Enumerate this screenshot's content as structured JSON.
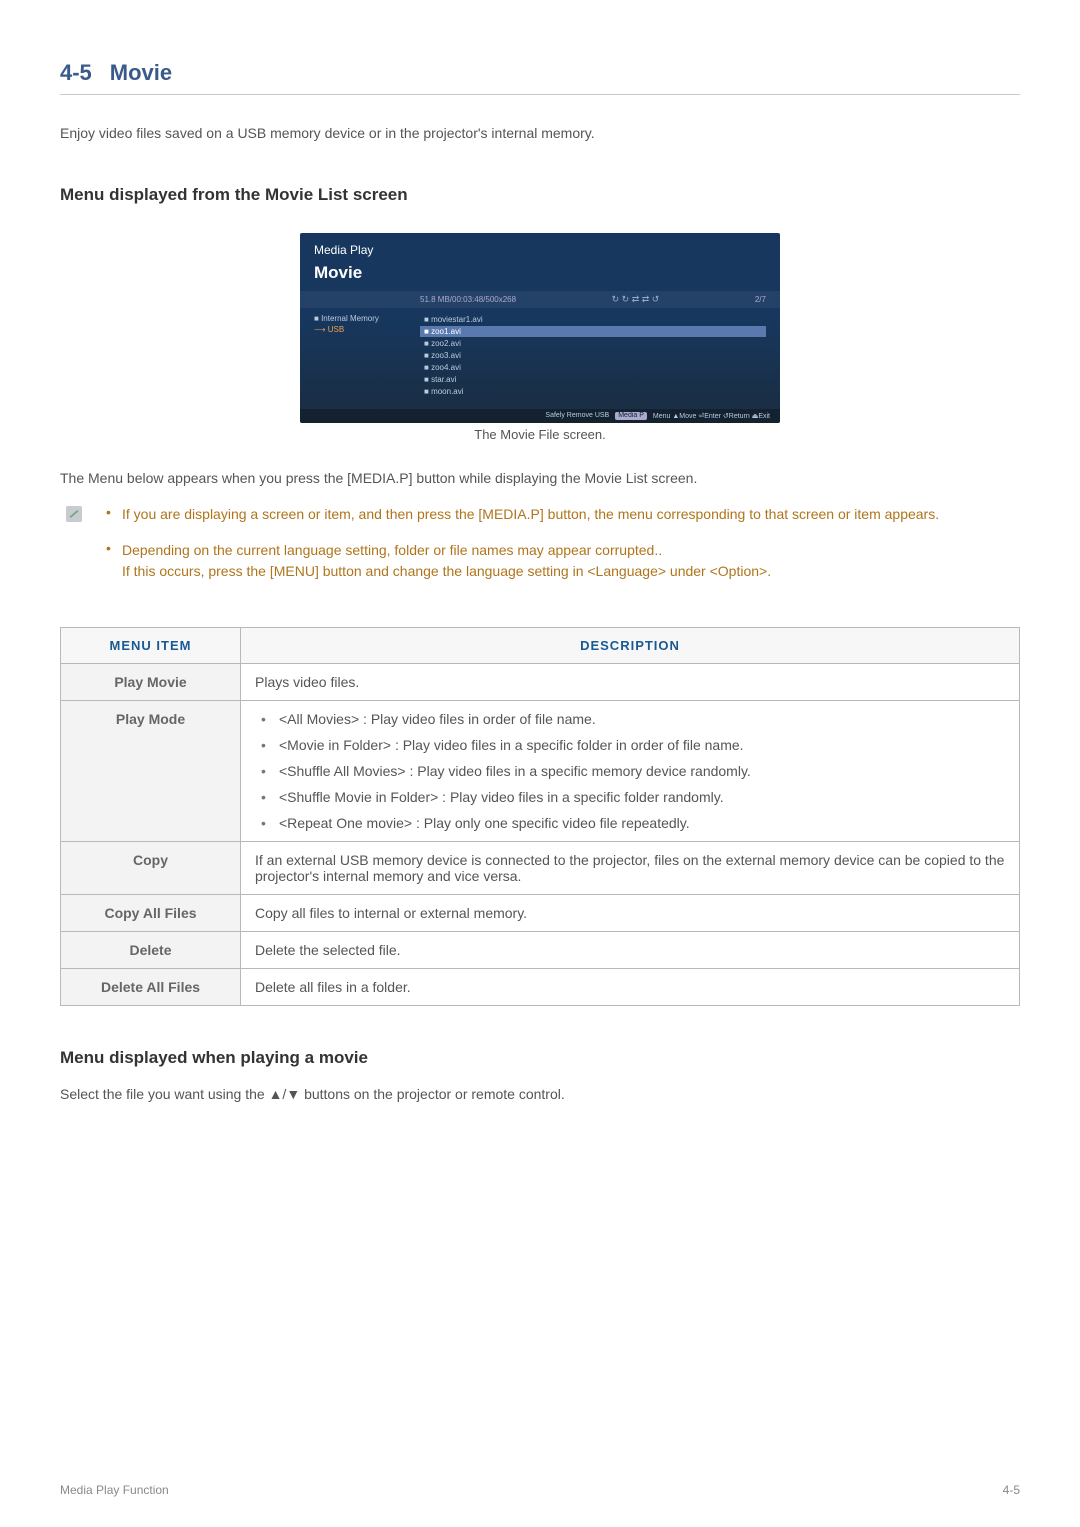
{
  "section": {
    "number": "4-5",
    "title": "Movie"
  },
  "intro": "Enjoy video files saved on a USB memory device or in the projector's internal memory.",
  "subsection1": "Menu displayed from the Movie List screen",
  "screenshot": {
    "app_title": "Media Play",
    "heading": "Movie",
    "info_bar": "51.8 MB/00:03:48/500x268",
    "page": "2/7",
    "left_items": [
      "Internal Memory",
      "USB"
    ],
    "files": [
      "moviestar1.avi",
      "zoo1.avi",
      "zoo2.avi",
      "zoo3.avi",
      "zoo4.avi",
      "star.avi",
      "moon.avi"
    ],
    "footer_left": "Safely Remove USB",
    "footer_badge": "Media P",
    "footer_items": "Menu  ▲Move  ⏎Enter  ↺Return  ⏏Exit"
  },
  "caption": "The Movie File screen.",
  "para1": "The Menu below appears when you press the [MEDIA.P] button while displaying the Movie List screen.",
  "notes": {
    "item1": "If you are displaying a screen or item, and then press the [MEDIA.P] button, the menu corresponding to that screen or item appears.",
    "item2a": "Depending on the current language setting, folder or file names may appear corrupted..",
    "item2b": "If this occurs, press the [MENU] button and change the language setting in <Language> under <Option>."
  },
  "table": {
    "header1": "MENU ITEM",
    "header2": "DESCRIPTION",
    "rows": {
      "play_movie": {
        "label": "Play Movie",
        "desc": "Plays video files."
      },
      "play_mode": {
        "label": "Play Mode",
        "items": [
          "<All Movies> : Play video files in order of file name.",
          "<Movie in Folder> : Play video files in a specific folder in order of file name.",
          "<Shuffle All Movies> : Play video files in a specific memory device randomly.",
          "<Shuffle Movie in Folder> : Play video files in a specific folder randomly.",
          "<Repeat One movie> : Play only one specific video file repeatedly."
        ]
      },
      "copy": {
        "label": "Copy",
        "desc": "If an external USB memory device is connected to the projector, files on the external memory device can be copied to the projector's internal memory and vice versa."
      },
      "copy_all": {
        "label": "Copy All Files",
        "desc": "Copy all files to internal or external memory."
      },
      "delete": {
        "label": "Delete",
        "desc": "Delete the selected file."
      },
      "delete_all": {
        "label": "Delete All Files",
        "desc": "Delete all files in a folder."
      }
    }
  },
  "subsection2": "Menu displayed when playing a movie",
  "para2": "Select the file you want using the ▲/▼ buttons on the projector or remote control.",
  "footer": {
    "left": "Media Play Function",
    "right": "4-5"
  }
}
